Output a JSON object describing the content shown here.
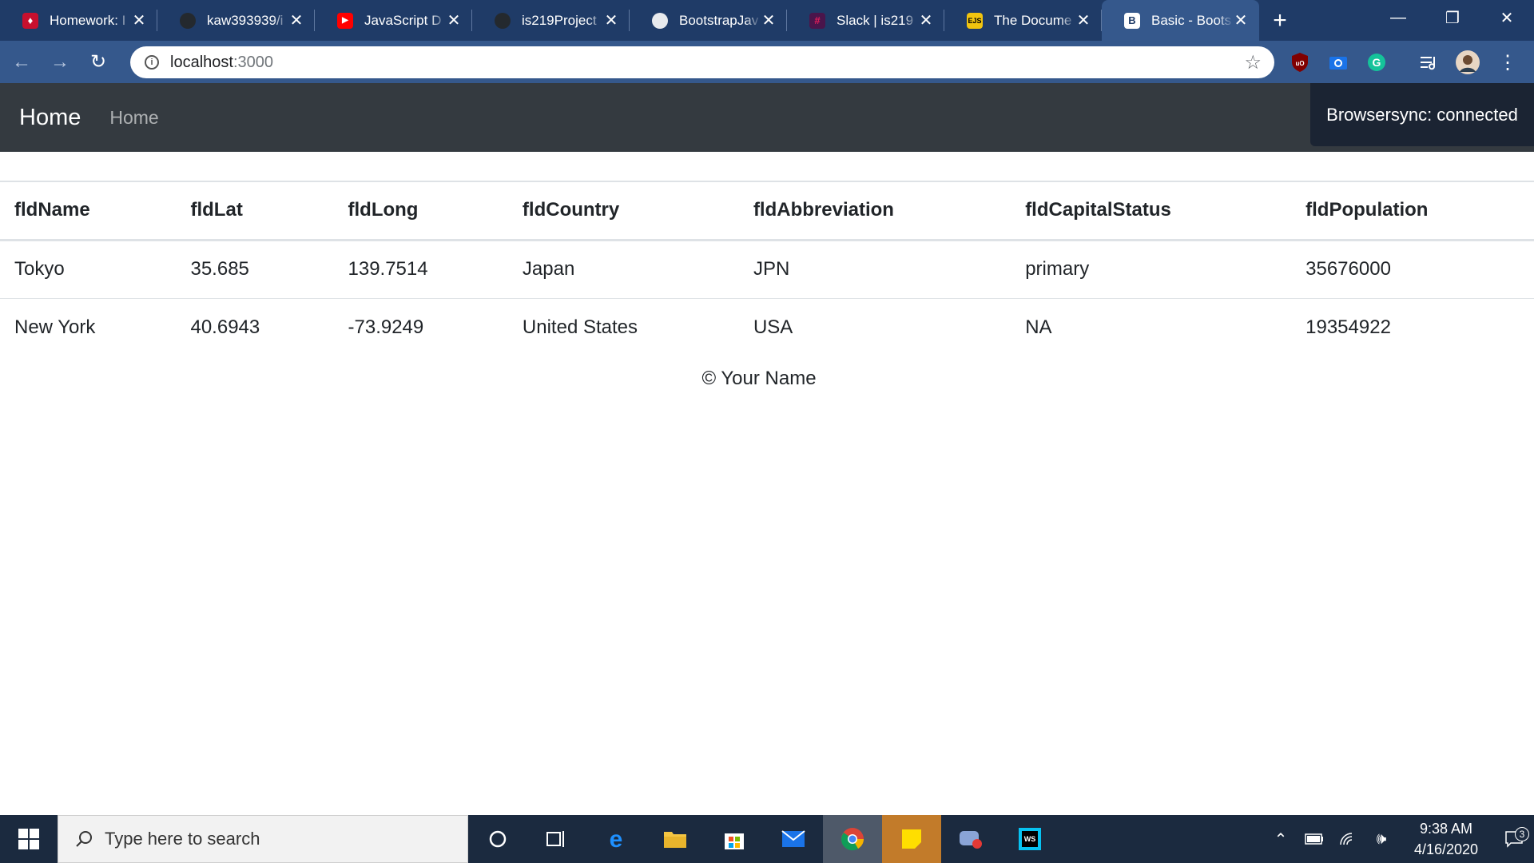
{
  "browser": {
    "tabs": [
      {
        "title": "Homework: I",
        "icon": "neu-icon",
        "color": "#c8102e",
        "active": false
      },
      {
        "title": "kaw393939/i",
        "icon": "github-icon",
        "color": "#24292e",
        "active": false
      },
      {
        "title": "JavaScript D",
        "icon": "youtube-icon",
        "color": "#ff0000",
        "active": false
      },
      {
        "title": "is219Project",
        "icon": "github-icon",
        "color": "#24292e",
        "active": false
      },
      {
        "title": "BootstrapJav",
        "icon": "globe-icon",
        "color": "#e8eaed",
        "active": false
      },
      {
        "title": "Slack | is219",
        "icon": "slack-icon",
        "color": "#4a154b",
        "active": false
      },
      {
        "title": "The Docume",
        "icon": "ejs-icon",
        "color": "#f1c40f",
        "active": false
      },
      {
        "title": "Basic - Boots",
        "icon": "bootstrap-icon",
        "color": "#ffffff",
        "active": true
      }
    ],
    "address": {
      "host": "localhost",
      "port": ":3000"
    }
  },
  "navbar": {
    "brand": "Home",
    "links": [
      "Home"
    ]
  },
  "browsersync": "Browsersync: connected",
  "table": {
    "columns": [
      "fldName",
      "fldLat",
      "fldLong",
      "fldCountry",
      "fldAbbreviation",
      "fldCapitalStatus",
      "fldPopulation"
    ],
    "rows": [
      [
        "Tokyo",
        "35.685",
        "139.7514",
        "Japan",
        "JPN",
        "primary",
        "35676000"
      ],
      [
        "New York",
        "40.6943",
        "-73.9249",
        "United States",
        "USA",
        "NA",
        "19354922"
      ]
    ]
  },
  "footer": "© Your Name",
  "taskbar": {
    "search_placeholder": "Type here to search",
    "time": "9:38 AM",
    "date": "4/16/2020",
    "notifications": "3"
  },
  "colors": {
    "tabstrip": "#1f3b67",
    "toolbar": "#35588c",
    "navbar": "#343a40",
    "taskbar": "#1b2a3f"
  }
}
